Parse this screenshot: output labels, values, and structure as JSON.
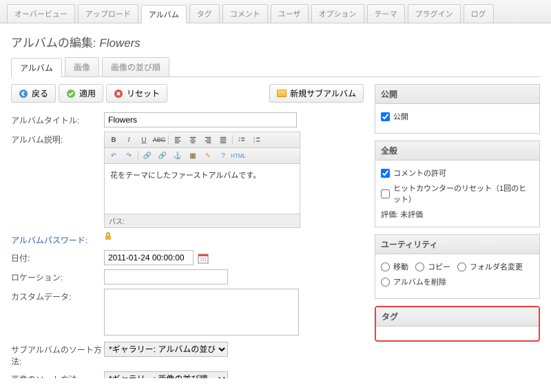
{
  "topTabs": [
    "オーバービュー",
    "アップロード",
    "アルバム",
    "タグ",
    "コメント",
    "ユーザ",
    "オプション",
    "テーマ",
    "プラグイン",
    "ログ"
  ],
  "topActive": 2,
  "pageTitle": {
    "prefix": "アルバムの編集:",
    "name": "Flowers"
  },
  "subTabs": [
    "アルバム",
    "画像",
    "画像の並び順"
  ],
  "subActive": 0,
  "toolbar": {
    "back": "戻る",
    "apply": "適用",
    "reset": "リセット",
    "newSub": "新規サブアルバム"
  },
  "form": {
    "titleLabel": "アルバムタイトル:",
    "title": "Flowers",
    "descLabel": "アルバム説明:",
    "desc": "花をテーマにしたファーストアルバムです。",
    "path": "パス:",
    "passLabel": "アルバムパスワード:",
    "dateLabel": "日付:",
    "date": "2011-01-24 00:00:00",
    "locLabel": "ロケーション:",
    "loc": "",
    "customLabel": "カスタムデータ:",
    "custom": "",
    "subSortLabel": "サブアルバムのソート方法:",
    "subSort": "*ギャラリー: アルバムの並び順",
    "imgSortLabel": "画像のソート方法:",
    "imgSort": "*ギャラリー: 画像の並び順"
  },
  "side": {
    "publish": {
      "head": "公開",
      "chk": "公開"
    },
    "general": {
      "head": "全般",
      "comment": "コメントの許可",
      "hit": "ヒットカウンターのリセット（1回のヒット）",
      "rating": "評価: 未評価"
    },
    "util": {
      "head": "ユーティリティ",
      "move": "移動",
      "copy": "コピー",
      "rename": "フォルダ名変更",
      "delete": "アルバムを削除"
    },
    "tag": {
      "head": "タグ"
    }
  }
}
